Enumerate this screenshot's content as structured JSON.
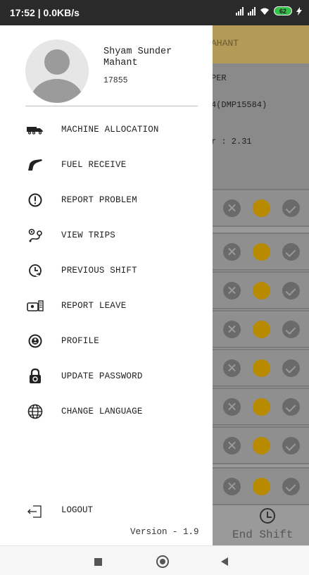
{
  "status_bar": {
    "time": "17:52",
    "speed": "0.0KB/s",
    "battery": "62"
  },
  "background": {
    "header_text": "AHANT",
    "info_lines": [
      "PER",
      "4(DMP15584)",
      "r : 2.31"
    ],
    "end_shift_label": "End Shift"
  },
  "drawer": {
    "user": {
      "name": "Shyam Sunder Mahant",
      "id": "17855"
    },
    "menu": [
      {
        "label": "MACHINE ALLOCATION",
        "icon": "truck-icon"
      },
      {
        "label": "FUEL RECEIVE",
        "icon": "fuel-nozzle-icon"
      },
      {
        "label": "REPORT PROBLEM",
        "icon": "alert-circle-icon"
      },
      {
        "label": "VIEW TRIPS",
        "icon": "route-icon"
      },
      {
        "label": "PREVIOUS SHIFT",
        "icon": "clock-history-icon"
      },
      {
        "label": "REPORT LEAVE",
        "icon": "leave-calendar-icon"
      },
      {
        "label": "PROFILE",
        "icon": "profile-icon"
      },
      {
        "label": "UPDATE PASSWORD",
        "icon": "lock-icon"
      },
      {
        "label": "CHANGE LANGUAGE",
        "icon": "globe-icon"
      }
    ],
    "logout_label": "LOGOUT",
    "version": "Version - 1.9"
  }
}
